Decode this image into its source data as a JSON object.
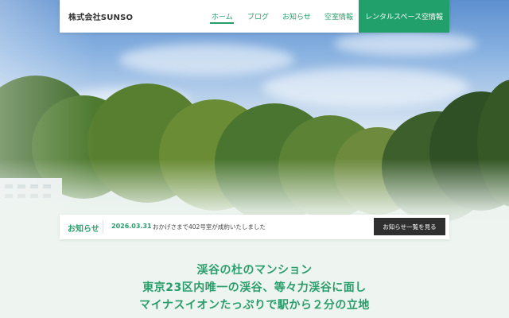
{
  "header": {
    "logo": "株式会社SUNSO",
    "nav": [
      "ホーム",
      "ブログ",
      "お知らせ",
      "空室情報"
    ],
    "active_nav": "ホーム",
    "cta": "レンタルスペース空情報"
  },
  "news": {
    "title": "お知らせ",
    "date": "2026.03.31",
    "text": "おかげさまで402号室が成約いたしました",
    "button": "お知らせ一覧を見る"
  },
  "headline": {
    "lines": [
      "渓谷の杜のマンション",
      "東京23区内唯一の渓谷、等々力渓谷に面し",
      "マイナスイオンたっぷりで駅から２分の立地"
    ]
  },
  "colors": {
    "accent": "#22a06b",
    "text_green": "#2a9d6b",
    "button_dark": "#2f2f2f",
    "background": "#eef5f0"
  }
}
